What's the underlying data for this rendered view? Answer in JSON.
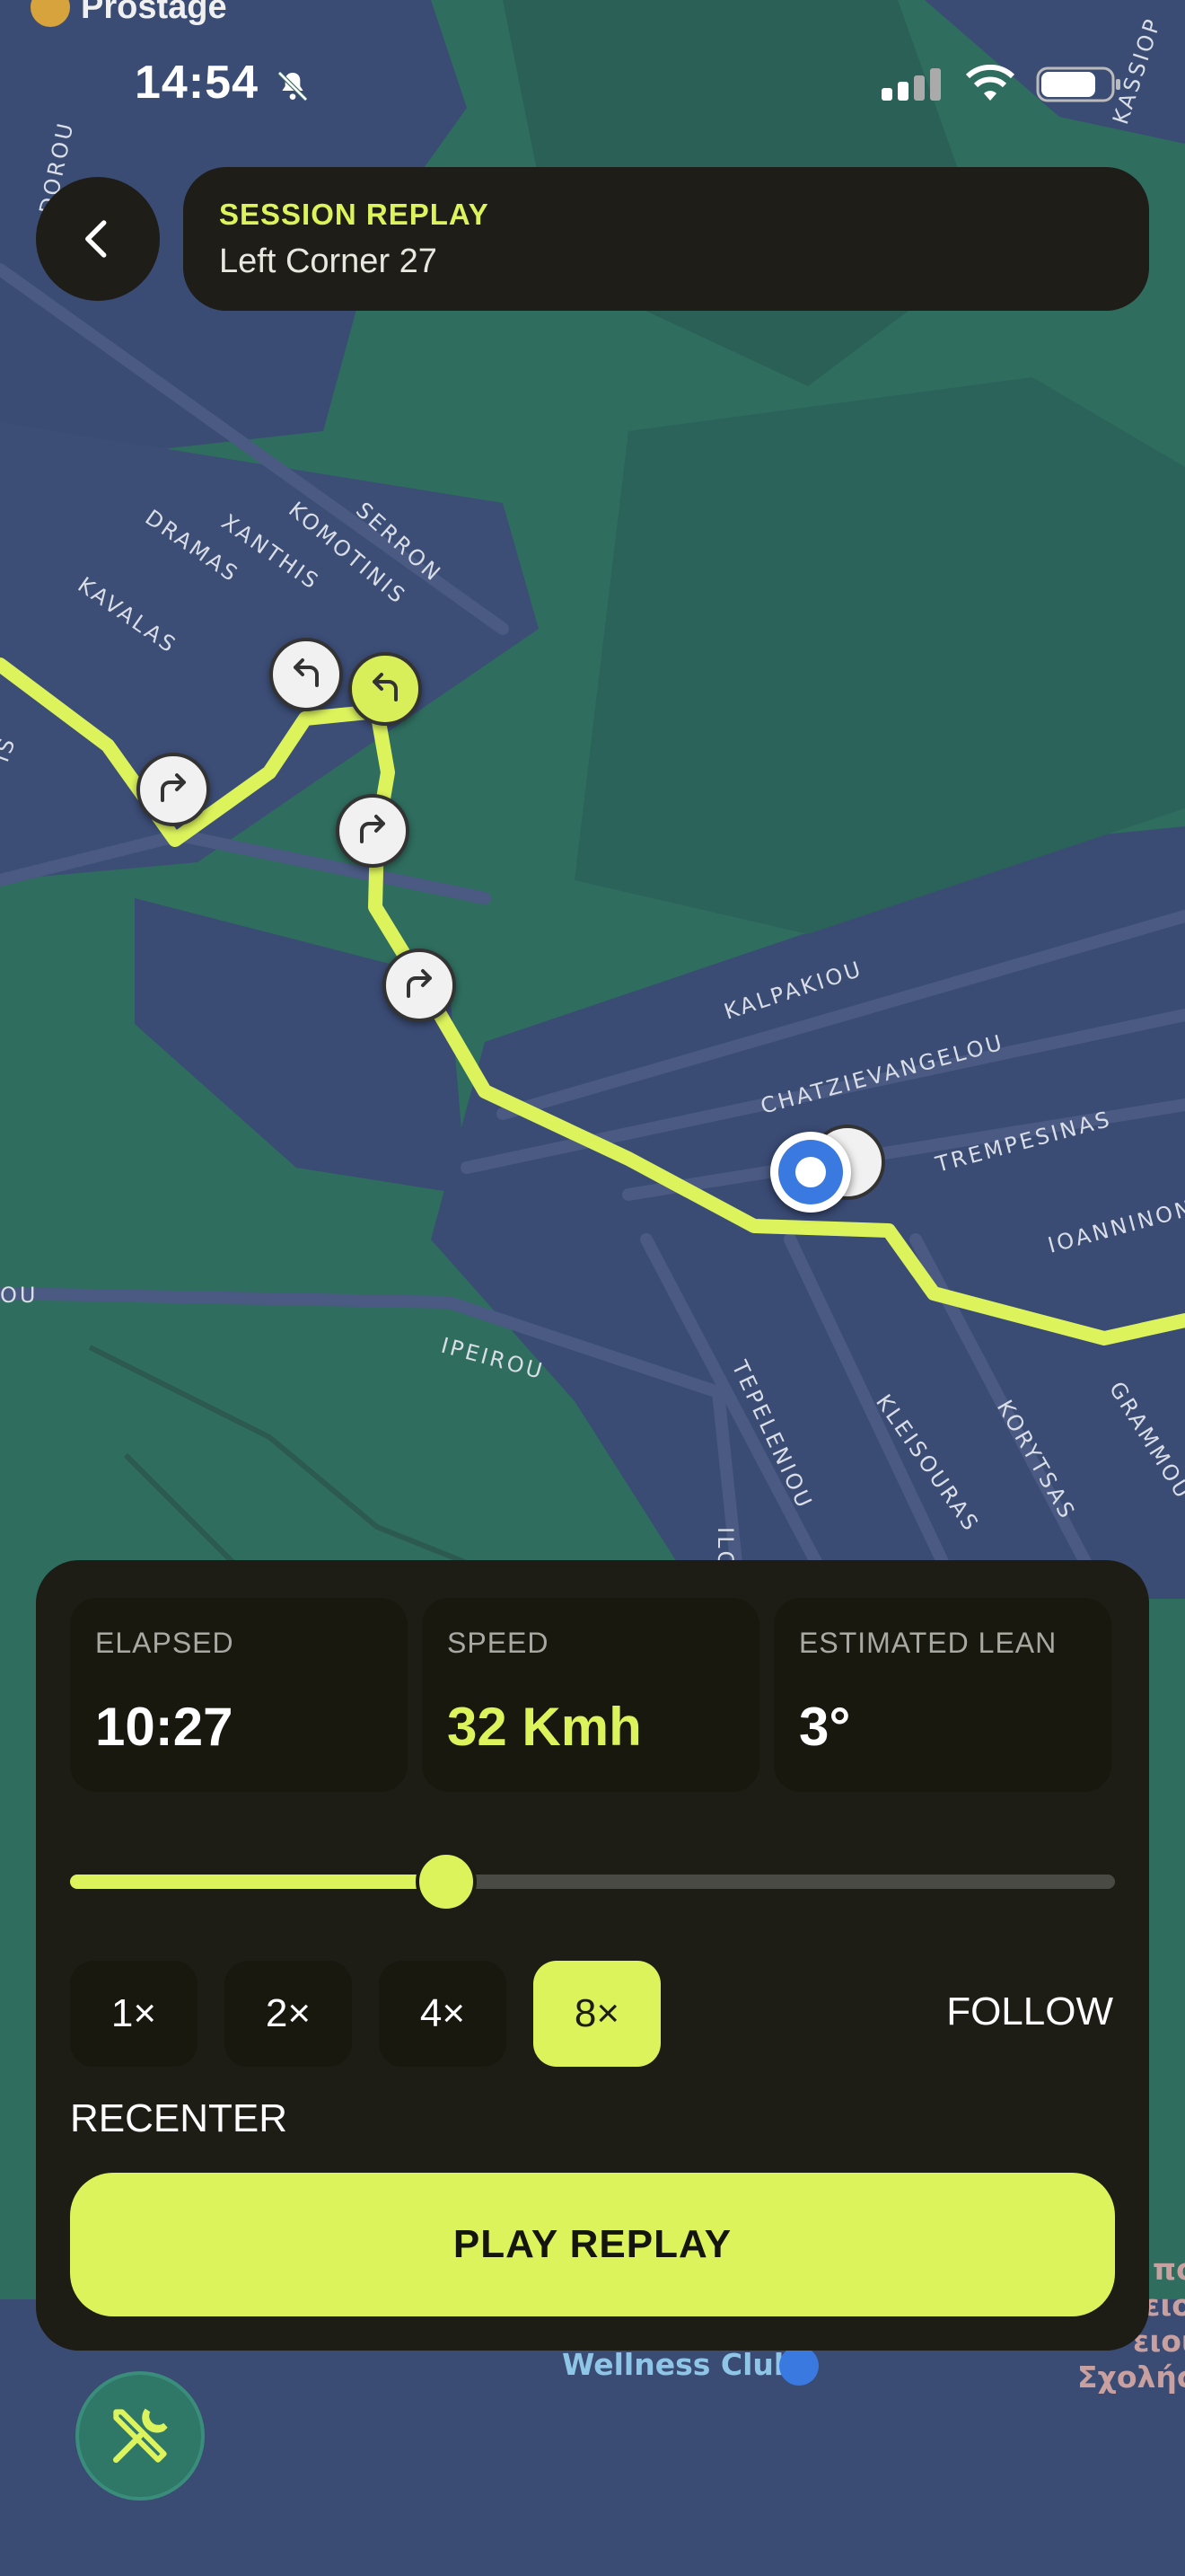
{
  "status": {
    "time": "14:54"
  },
  "header": {
    "kicker": "SESSION REPLAY",
    "session_name": "Left Corner 27"
  },
  "map": {
    "poi_top": "Prostage",
    "poi_bottom": "Wellness Club",
    "greek_lines": [
      "πο",
      "ειο",
      "ειου",
      "Σχολής"
    ],
    "streets": {
      "dramas": "DRAMAS",
      "kavalas": "KAVALAS",
      "xanthis": "XANTHIS",
      "komotinis": "KOMOTINIS",
      "serron": "SERRON",
      "kalpakiou": "KALPAKIOU",
      "chatzievangelou": "CHATZIEVANGELOU",
      "trempesinas": "TREMPESINAS",
      "ioanninon": "IOANNINON",
      "ipeirou": "IPEIROU",
      "tepeleniou": "TEPELENIOU",
      "kleisouras": "KLEISOURAS",
      "korytsas": "KORYTSAS",
      "grammou": "GRAMMOU",
      "kassiop": "KASSIOP",
      "dorou": "DOROU",
      "ou": "OU",
      "is": "IS",
      "ilc": "ILC"
    }
  },
  "stats": {
    "elapsed_label": "ELAPSED",
    "elapsed_value": "10:27",
    "speed_label": "SPEED",
    "speed_value": "32 Kmh",
    "lean_label": "ESTIMATED LEAN",
    "lean_value": "3°"
  },
  "playback": {
    "progress": 0.36,
    "speeds": [
      "1×",
      "2×",
      "4×",
      "8×"
    ],
    "selected_speed": "8×",
    "follow_label": "FOLLOW",
    "recenter_label": "RECENTER",
    "play_label": "PLAY REPLAY"
  },
  "colors": {
    "accent": "#dcf35c",
    "panel": "#1d1c15",
    "map_water": "#2f6d5f",
    "map_blocks": "#3a4b74",
    "route": "#dcf35c"
  },
  "icons": {
    "back": "chevron-left-icon",
    "turn_left": "turn-left-icon",
    "turn_right": "turn-right-icon",
    "tools": "tools-icon",
    "mute": "bell-slash-icon"
  }
}
